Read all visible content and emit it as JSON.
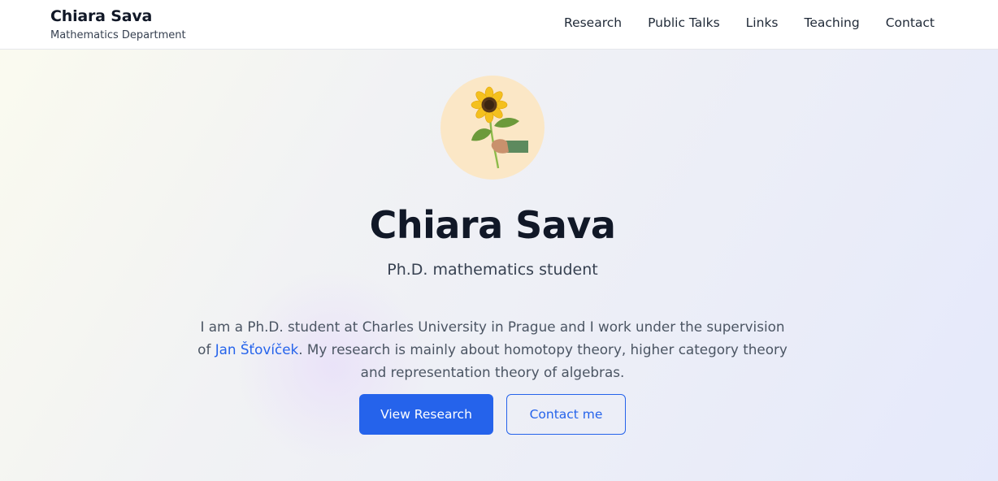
{
  "header": {
    "brand_name": "Chiara Sava",
    "brand_subtitle": "Mathematics Department",
    "nav": [
      {
        "label": "Research"
      },
      {
        "label": "Public Talks"
      },
      {
        "label": "Links"
      },
      {
        "label": "Teaching"
      },
      {
        "label": "Contact"
      }
    ]
  },
  "hero": {
    "avatar_icon": "sunflower-in-hand-icon",
    "name": "Chiara Sava",
    "subtitle": "Ph.D. mathematics student",
    "bio_part1": "I am a Ph.D. student at Charles University in Prague and I work under the supervision of ",
    "bio_link": "Jan Šťovíček",
    "bio_part2": ". My research is mainly about homotopy theory, higher category theory and representation theory of algebras.",
    "primary_button": "View Research",
    "secondary_button": "Contact me"
  },
  "colors": {
    "accent": "#2563eb",
    "avatar_bg": "#fbe7c6",
    "heading": "#111827"
  }
}
